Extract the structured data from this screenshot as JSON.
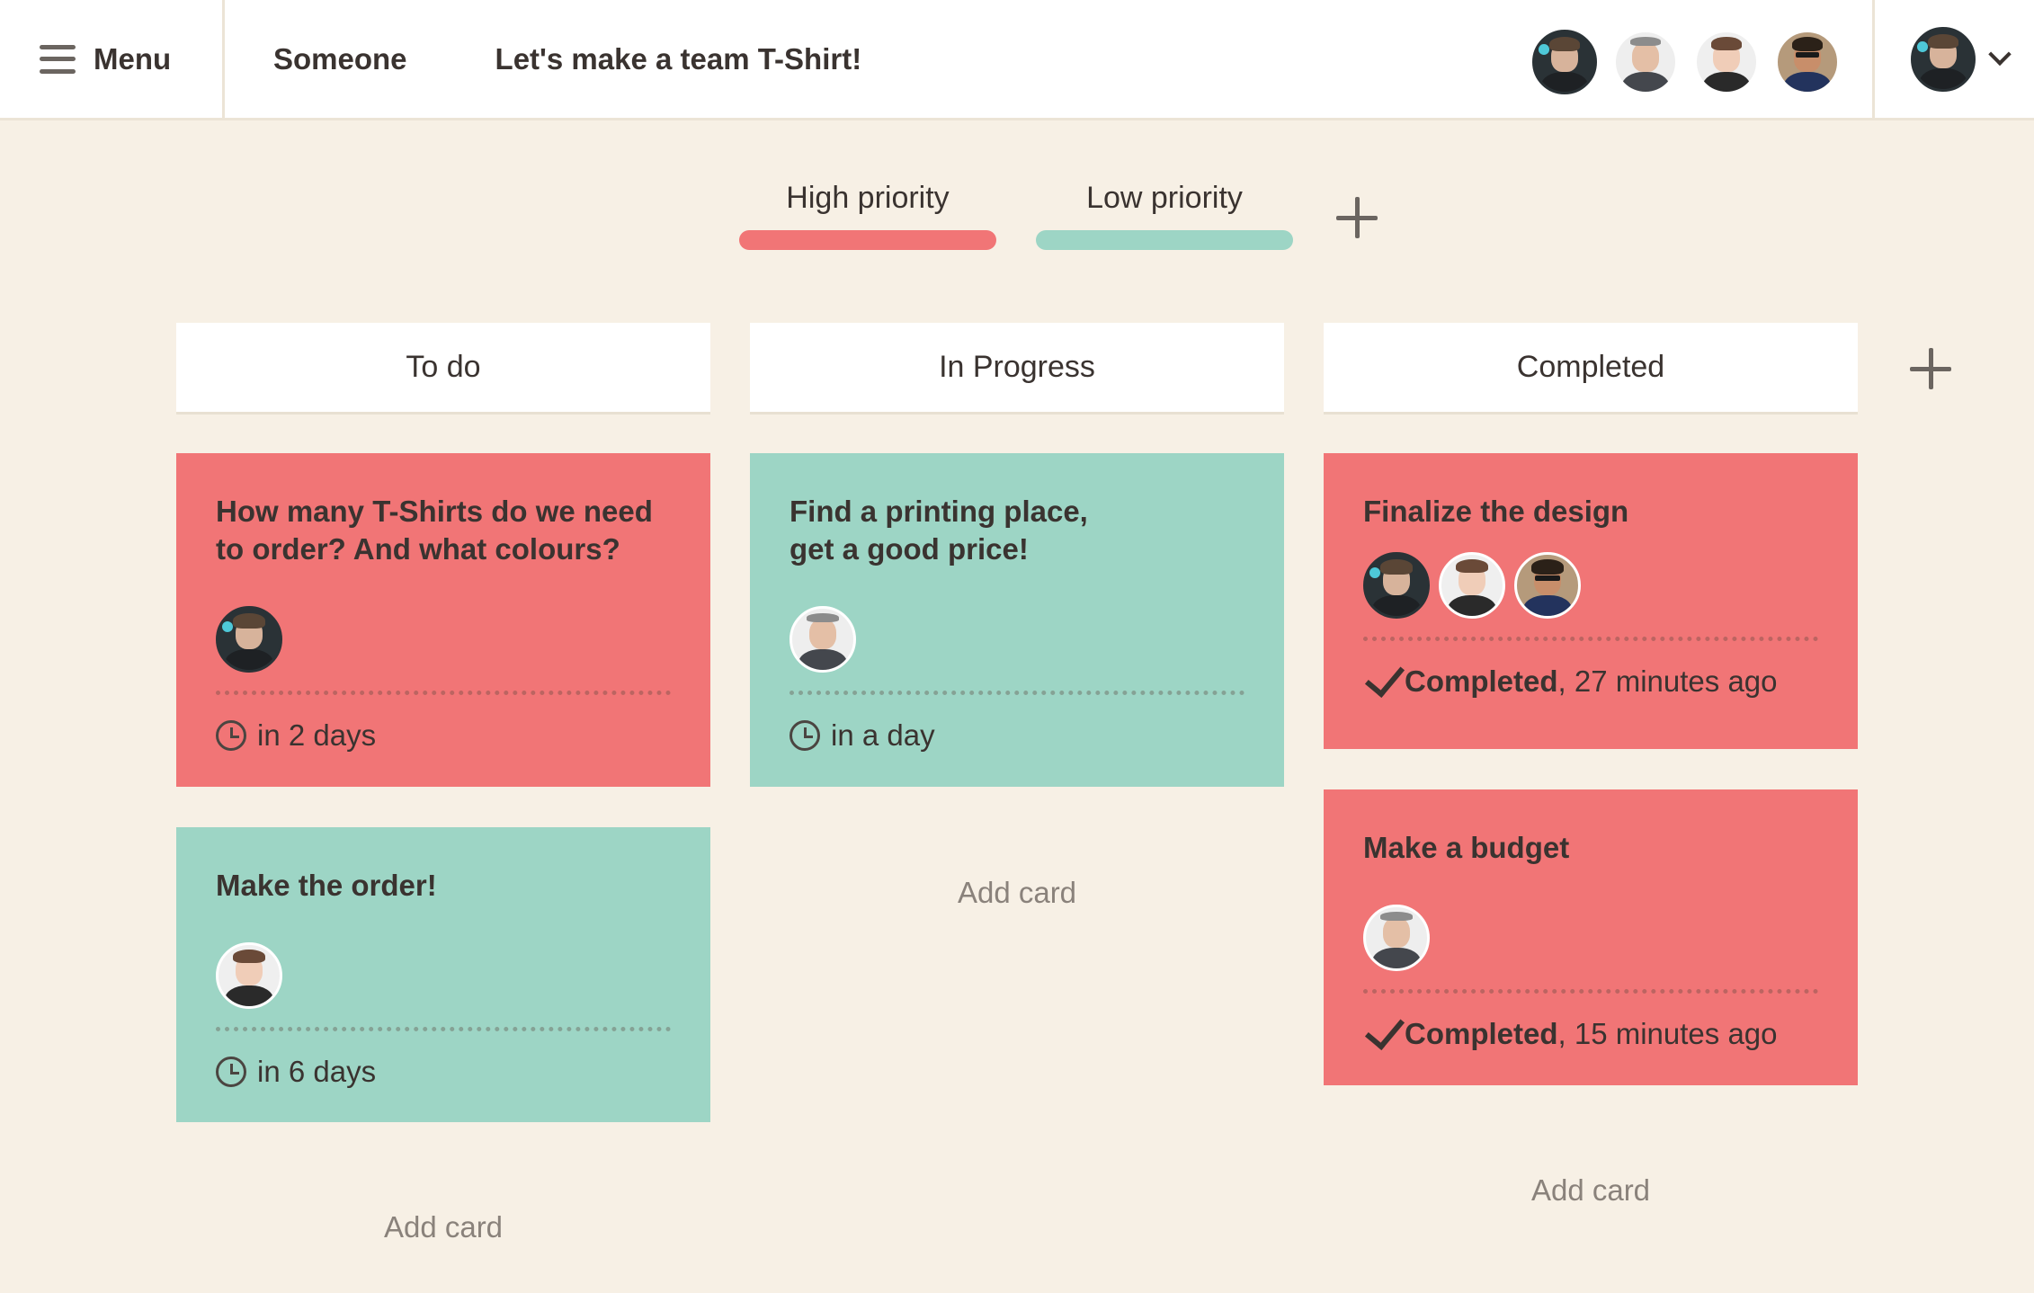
{
  "topbar": {
    "menu_label": "Menu",
    "owner": "Someone",
    "board_title": "Let's make a team T-Shirt!",
    "members": [
      "member-1",
      "member-2",
      "member-3",
      "member-4"
    ]
  },
  "labels": [
    {
      "name": "High priority",
      "color": "#f17576"
    },
    {
      "name": "Low priority",
      "color": "#9dd5c5"
    }
  ],
  "columns": [
    {
      "title": "To do",
      "add_card": "Add card",
      "cards": [
        {
          "title": "How many T-Shirts do we need to order? And what colours?",
          "due": "in 2 days",
          "priority": "high"
        },
        {
          "title": "Make the order!",
          "due": "in 6 days",
          "priority": "low"
        }
      ]
    },
    {
      "title": "In Progress",
      "add_card": "Add card",
      "cards": [
        {
          "title": "Find a printing place, get a good price!",
          "due": "in a day",
          "priority": "low"
        }
      ]
    },
    {
      "title": "Completed",
      "add_card": "Add card",
      "cards": [
        {
          "title": "Finalize the design",
          "status": "Completed",
          "time": ", 27 minutes ago",
          "priority": "high"
        },
        {
          "title": "Make a budget",
          "status": "Completed",
          "time": ", 15 minutes ago",
          "priority": "high"
        }
      ]
    }
  ]
}
